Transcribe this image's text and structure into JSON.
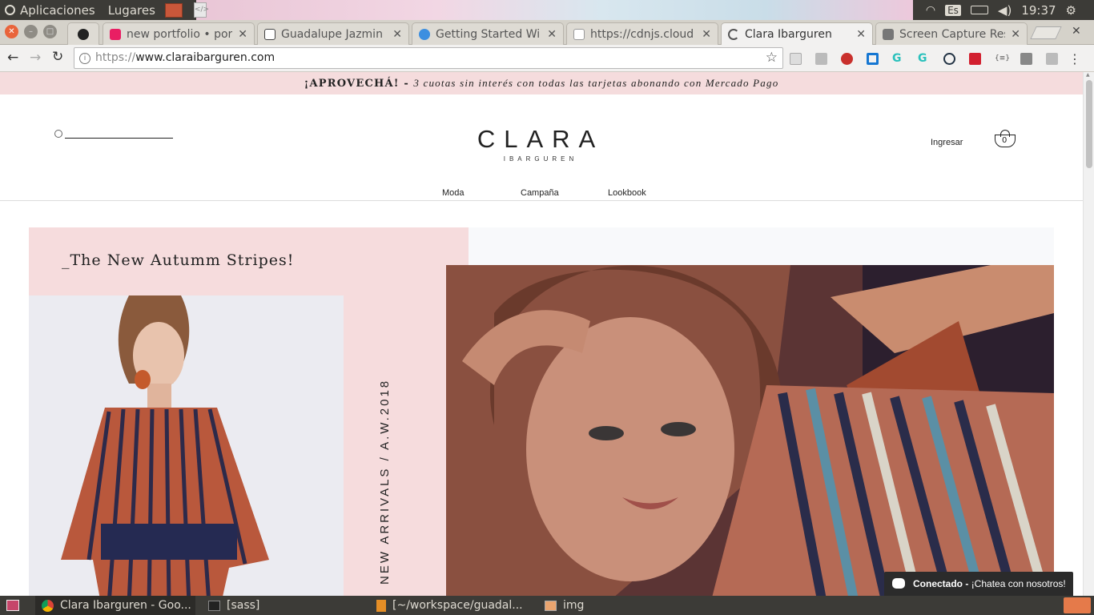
{
  "system_bar": {
    "menu_apps": "Aplicaciones",
    "menu_places": "Lugares",
    "keyboard_layout": "Es",
    "clock": "19:37"
  },
  "tabs": [
    {
      "title": "new portfolio • por",
      "favicon_color": "#e91e63"
    },
    {
      "title": "Guadalupe Jazmin",
      "favicon_color": "#ffffff"
    },
    {
      "title": "Getting Started Wi",
      "favicon_color": "#3d8fe0"
    },
    {
      "title": "https://cdnjs.cloud",
      "favicon_color": "#ffffff"
    },
    {
      "title": "Clara Ibarguren",
      "favicon_color": "#ffffff"
    },
    {
      "title": "Screen Capture Res",
      "favicon_color": "#777777"
    }
  ],
  "address_bar": {
    "scheme": "https://",
    "host": "www.claraibarguren.com"
  },
  "site": {
    "promo": {
      "strong": "¡APROVECHÁ! -",
      "text": "3 cuotas sin interés con todas las tarjetas abonando con Mercado Pago"
    },
    "logo_main": "CLARA",
    "logo_sub": "IBARGUREN",
    "login": "Ingresar",
    "cart_count": "0",
    "nav": [
      "Moda",
      "Campaña",
      "Lookbook"
    ],
    "headline": "_The New Autumm Stripes!",
    "vertical_text": "NEW ARRIVALS / A.W.2018",
    "chat": {
      "status": "Conectado -",
      "text": "¡Chatea con nosotros!"
    }
  },
  "taskbar": [
    {
      "label": "Clara Ibarguren - Goo..."
    },
    {
      "label": "[sass]"
    },
    {
      "label": "[~/workspace/guadal..."
    },
    {
      "label": "img"
    }
  ],
  "colors": {
    "promo_bg": "#f5dcdd",
    "hero_pink": "#f6dcdd",
    "os_dark": "#3c3b37"
  }
}
